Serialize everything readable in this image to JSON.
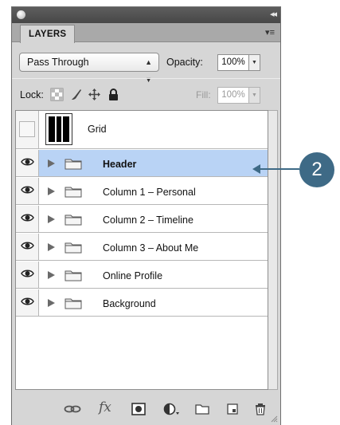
{
  "panel": {
    "tab_label": "LAYERS",
    "panel_menu_icon": "panel-menu-icon",
    "collapse_icon": "collapse-icon"
  },
  "blend": {
    "mode": "Pass Through",
    "opacity_label": "Opacity:",
    "opacity_value": "100%"
  },
  "lock": {
    "label": "Lock:",
    "icons": [
      "lock-transparent-icon",
      "lock-image-icon",
      "lock-position-icon",
      "lock-all-icon"
    ],
    "fill_label": "Fill:",
    "fill_value": "100%"
  },
  "layers": [
    {
      "name": "Grid",
      "type": "layer",
      "visible": false,
      "selected": false
    },
    {
      "name": "Header",
      "type": "group",
      "visible": true,
      "selected": true
    },
    {
      "name": "Column 1 – Personal",
      "type": "group",
      "visible": true,
      "selected": false
    },
    {
      "name": "Column 2 – Timeline",
      "type": "group",
      "visible": true,
      "selected": false
    },
    {
      "name": "Column 3 – About Me",
      "type": "group",
      "visible": true,
      "selected": false
    },
    {
      "name": "Online Profile",
      "type": "group",
      "visible": true,
      "selected": false
    },
    {
      "name": "Background",
      "type": "group",
      "visible": true,
      "selected": false
    }
  ],
  "toolbar": {
    "icons": [
      "link-layers-icon",
      "layer-style-fx-icon",
      "layer-mask-icon",
      "adjustment-layer-icon",
      "new-group-icon",
      "new-layer-icon",
      "delete-layer-icon"
    ],
    "fx_text": "fx"
  },
  "callout": {
    "number": "2",
    "color": "#3e6a86"
  },
  "colors": {
    "selection": "#b9d3f5",
    "panel": "#d6d6d6"
  }
}
